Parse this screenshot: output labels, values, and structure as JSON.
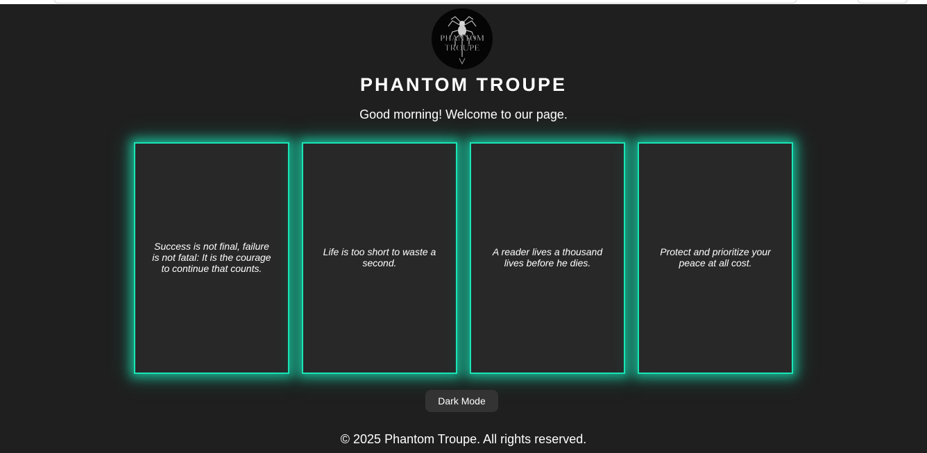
{
  "header": {
    "logo_text_line1": "PHANTOM",
    "logo_text_line2": "TROUPE",
    "logo_icon": "spider-icon",
    "title": "PHANTOM TROUPE",
    "greeting": "Good morning! Welcome to our page."
  },
  "cards": [
    {
      "quote": "Success is not final, failure is not fatal: It is the courage to continue that counts."
    },
    {
      "quote": "Life is too short to waste a second."
    },
    {
      "quote": "A reader lives a thousand lives before he dies."
    },
    {
      "quote": "Protect and prioritize your peace at all cost."
    }
  ],
  "controls": {
    "mode_button_label": "Dark Mode"
  },
  "footer": {
    "text": "© 2025 Phantom Troupe. All rights reserved."
  },
  "colors": {
    "background": "#1f1f1f",
    "card_background": "#282828",
    "card_glow": "#19e6b8",
    "button_background": "#333333",
    "text": "#ffffff"
  }
}
